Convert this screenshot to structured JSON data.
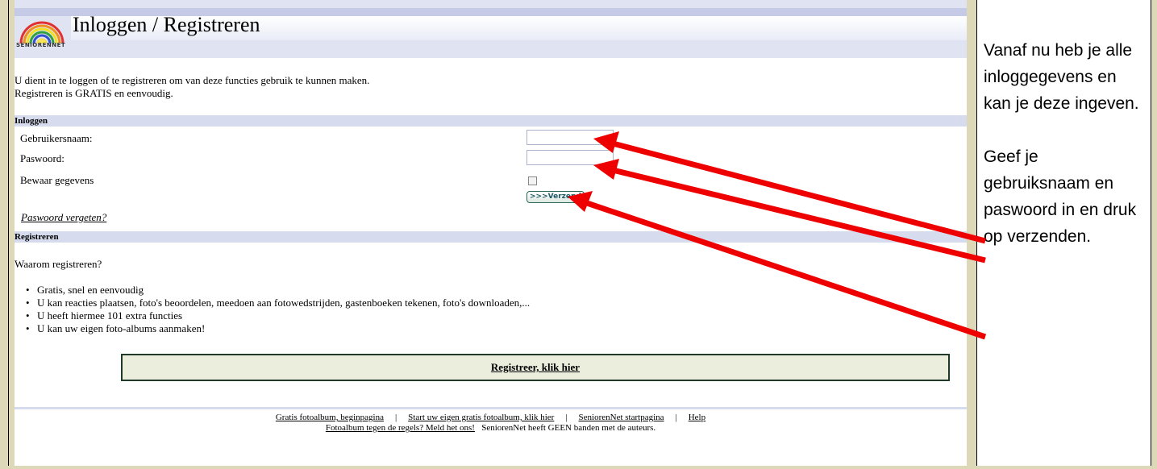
{
  "header": {
    "title": "Inloggen / Registreren",
    "logo_text": "SENIORENNET"
  },
  "intro": {
    "line1": "U dient in te loggen of te registreren om van deze functies gebruik te kunnen maken.",
    "line2": "Registreren is GRATIS en eenvoudig."
  },
  "login": {
    "section_label": "Inloggen",
    "username_label": "Gebruikersnaam:",
    "username_value": "",
    "password_label": "Paswoord:",
    "password_value": "",
    "remember_label": "Bewaar gegevens",
    "remember_checked": false,
    "send_button": ">>>Verzenden",
    "forgot_link": "Paswoord vergeten?"
  },
  "register": {
    "section_label": "Registreren",
    "why": "Waarom registreren?",
    "bullets": [
      "Gratis, snel en eenvoudig",
      "U kan reacties plaatsen, foto's beoordelen, meedoen aan fotowedstrijden, gastenboeken tekenen, foto's downloaden,...",
      "U heeft hiermee 101 extra functies",
      "U kan uw eigen foto-albums aanmaken!"
    ],
    "button": "Registreer, klik hier"
  },
  "footer": {
    "link1": "Gratis fotoalbum, beginpagina",
    "link2": "Start uw eigen gratis fotoalbum, klik hier",
    "link3": "SeniorenNet startpagina",
    "link4": "Help",
    "separator": "|",
    "report_link": "Fotoalbum tegen de regels? Meld het ons!",
    "disclaimer": "SeniorenNet heeft GEEN banden met de auteurs."
  },
  "note": {
    "paragraph1": "Vanaf nu heb je alle inloggegevens en kan je deze ingeven.",
    "paragraph2": "Geef je gebruiksnaam en paswoord in en druk op verzenden."
  },
  "colors": {
    "arrow": "#ee0000",
    "frame": "#ddd8b8",
    "section_bar": "#d6dbee"
  }
}
